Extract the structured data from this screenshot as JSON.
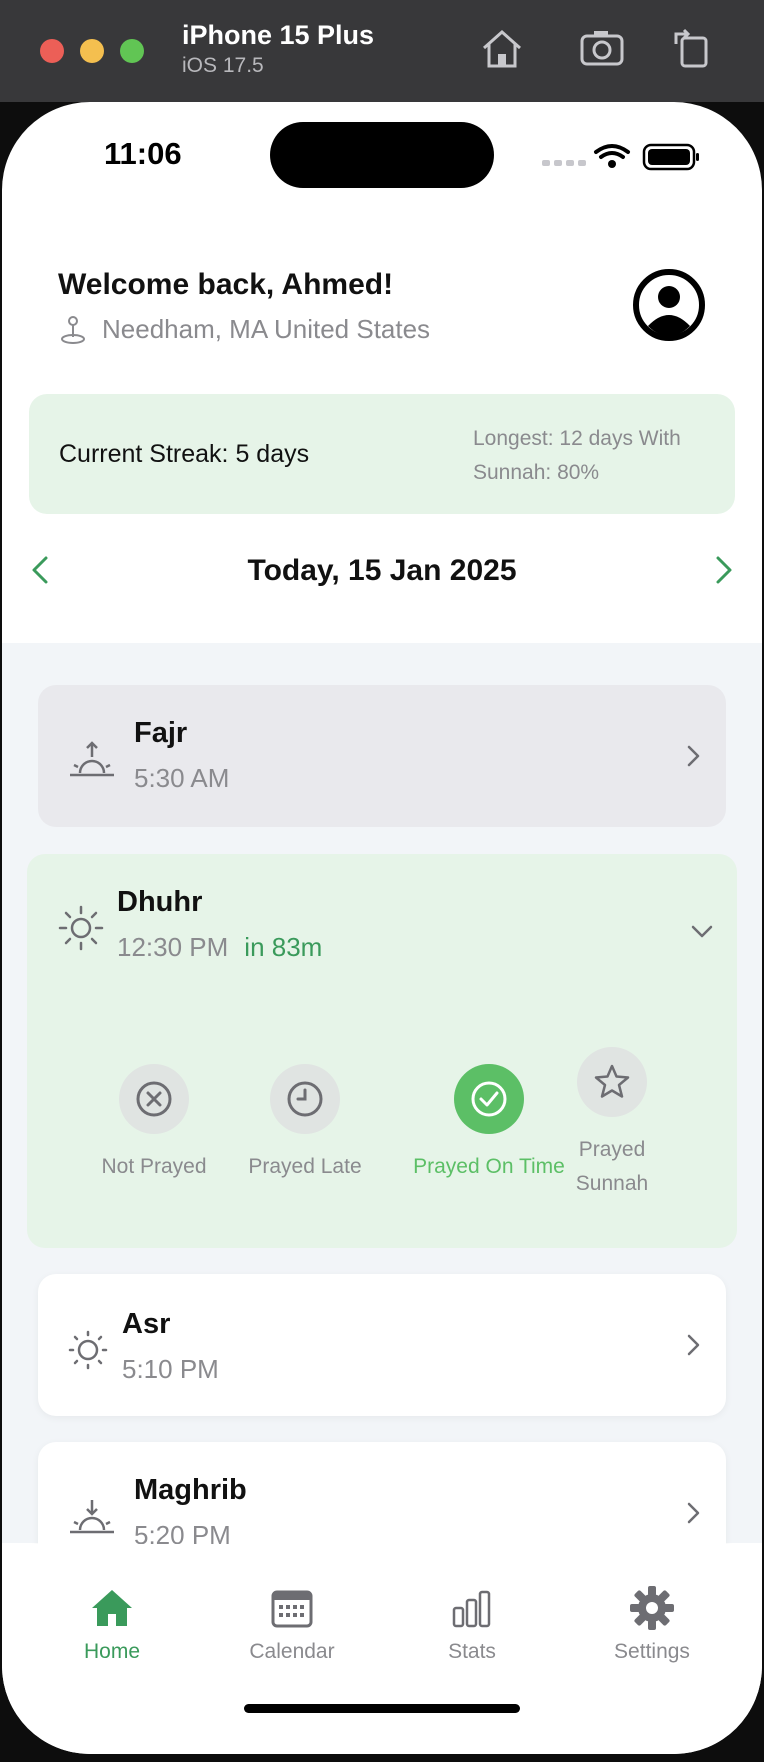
{
  "simulator": {
    "device": "iPhone 15 Plus",
    "os": "iOS 17.5",
    "icons": [
      "home-icon",
      "screenshot-icon",
      "rotate-icon"
    ]
  },
  "status_bar": {
    "time": "11:06"
  },
  "header": {
    "greeting": "Welcome back, Ahmed!",
    "location": "Needham, MA United States"
  },
  "streak": {
    "current": "Current Streak: 5 days",
    "longest": "Longest: 12 days  With Sunnah: 80%"
  },
  "date_nav": {
    "title": "Today, 15 Jan 2025"
  },
  "prayers": [
    {
      "name": "Fajr",
      "time": "5:30 AM"
    },
    {
      "name": "Dhuhr",
      "time": "12:30 PM",
      "countdown": "in 83m"
    },
    {
      "name": "Asr",
      "time": "5:10 PM"
    },
    {
      "name": "Maghrib",
      "time": "5:20 PM"
    }
  ],
  "dhuhr_options": [
    {
      "label": "Not Prayed",
      "selected": false
    },
    {
      "label": "Prayed Late",
      "selected": false
    },
    {
      "label": "Prayed On Time",
      "selected": true
    },
    {
      "label": "Prayed Sunnah",
      "selected": false
    }
  ],
  "tabs": [
    {
      "label": "Home",
      "active": true
    },
    {
      "label": "Calendar",
      "active": false
    },
    {
      "label": "Stats",
      "active": false
    },
    {
      "label": "Settings",
      "active": false
    }
  ],
  "colors": {
    "accent": "#3a9a5b",
    "selected_option": "#5cbf66",
    "streak_bg": "#e6f4e8",
    "muted_text": "#8a8a8e"
  }
}
